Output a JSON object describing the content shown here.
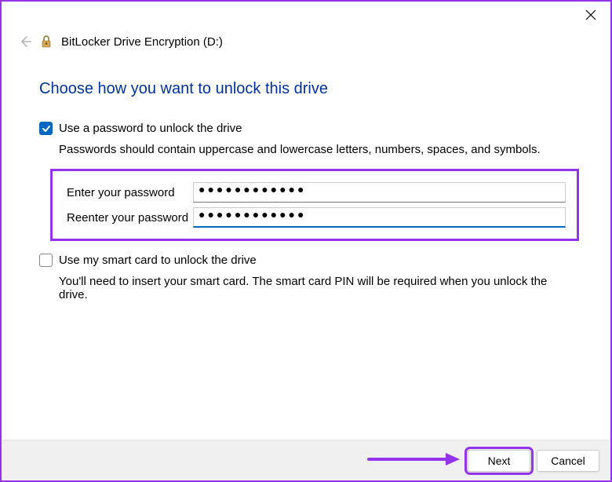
{
  "window": {
    "title": "BitLocker Drive Encryption (D:)"
  },
  "heading": "Choose how you want to unlock this drive",
  "password_option": {
    "checkbox_label": "Use a password to unlock the drive",
    "hint": "Passwords should contain uppercase and lowercase letters, numbers, spaces, and symbols.",
    "enter_label": "Enter your password",
    "reenter_label": "Reenter your password",
    "enter_value": "●●●●●●●●●●●●",
    "reenter_value": "●●●●●●●●●●●●"
  },
  "smartcard_option": {
    "checkbox_label": "Use my smart card to unlock the drive",
    "hint": "You'll need to insert your smart card. The smart card PIN will be required when you unlock the drive."
  },
  "footer": {
    "next": "Next",
    "cancel": "Cancel"
  }
}
